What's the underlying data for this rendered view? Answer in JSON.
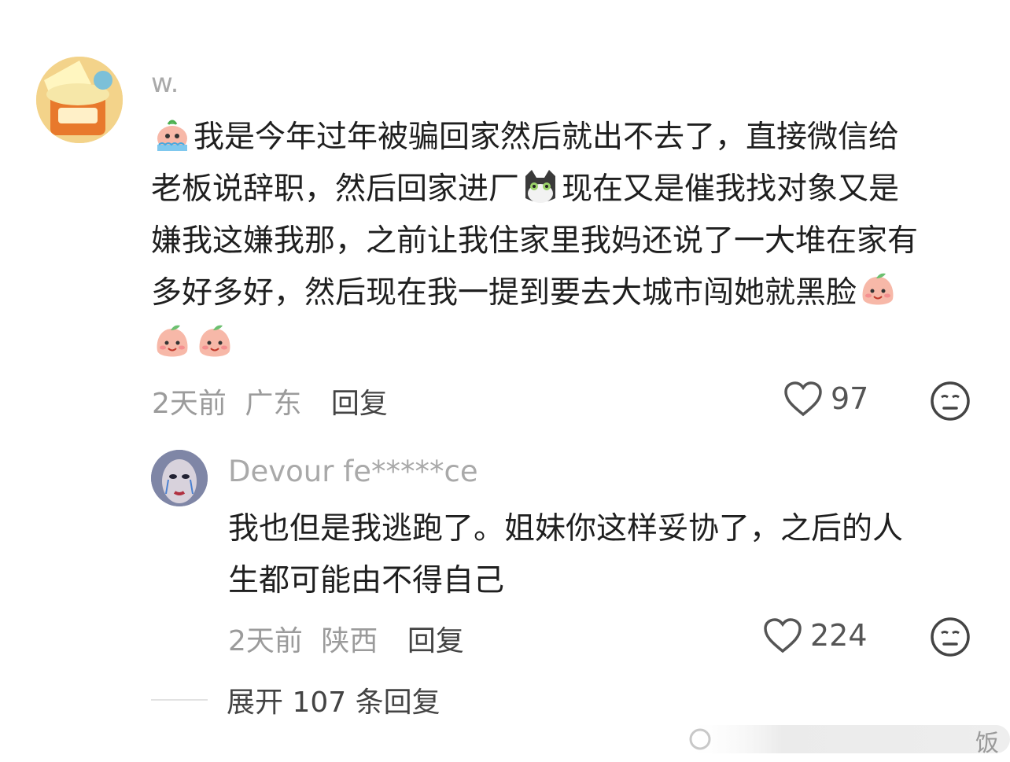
{
  "comment": {
    "username": "w.",
    "lines": [
      "我是今年过年被骗回家然后就出不去了，直接微信给",
      "老板说辞职，然后回家进厂",
      "现在又是催我找对象又是",
      "嫌我这嫌我那，之前让我住家里我妈还说了一大堆在家有",
      "多好多好，然后现在我一提到要去大城市闯她就黑脸"
    ],
    "time": "2天前",
    "location": "广东",
    "reply_label": "回复",
    "likes": "97",
    "emoji_names": [
      "crying-face-emoji",
      "cat-emoji",
      "peach-face-emoji"
    ]
  },
  "reply": {
    "username": "Devour fe*****ce",
    "lines": [
      "我也但是我逃跑了。姐妹你这样妥协了，之后的人",
      "生都可能由不得自己"
    ],
    "time": "2天前",
    "location": "陕西",
    "reply_label": "回复",
    "likes": "224"
  },
  "expand": {
    "label": "展开 107 条回复"
  },
  "watermark": {
    "text": "饭"
  },
  "colors": {
    "text": "#1f1f1f",
    "meta": "#9b9b9b",
    "name": "#a9a9a9",
    "emoji_peach": "#f7b8a8"
  }
}
